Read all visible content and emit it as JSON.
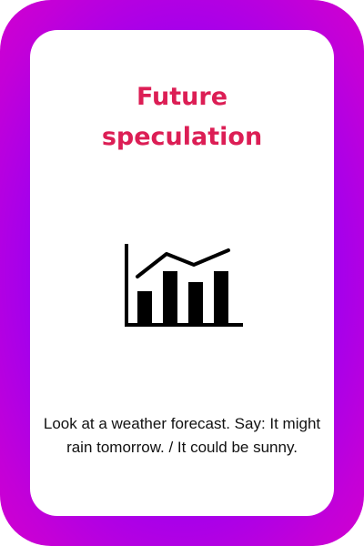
{
  "card": {
    "title": "Future\nspeculation",
    "description": "Look at a weather forecast. Say: It might rain tomorrow. / It could be sunny.",
    "icon": "bar-line-chart-icon",
    "colors": {
      "title": "#dc1e55",
      "frame_inner": "#8a00ff",
      "frame_outer": "#d100cf",
      "icon": "#000000"
    }
  }
}
